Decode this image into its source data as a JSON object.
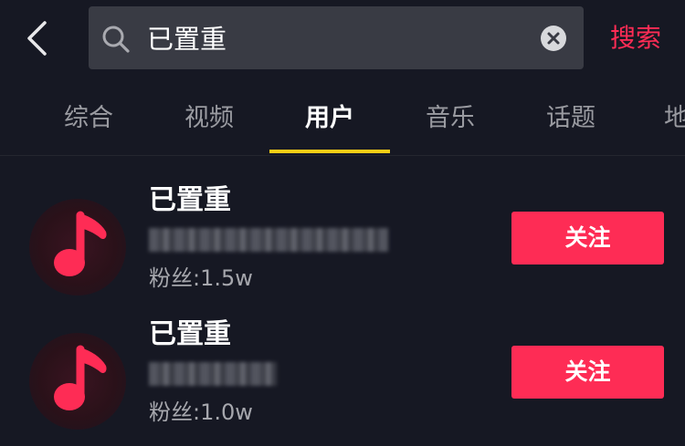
{
  "search": {
    "query": "已置重",
    "submit_label": "搜索"
  },
  "tabs": [
    {
      "label": "综合"
    },
    {
      "label": "视频"
    },
    {
      "label": "用户"
    },
    {
      "label": "音乐"
    },
    {
      "label": "话题"
    },
    {
      "label": "地"
    }
  ],
  "active_tab": "用户",
  "results": [
    {
      "name": "已置重",
      "followers": "粉丝:1.5w",
      "follow_label": "关注"
    },
    {
      "name": "已置重",
      "followers": "粉丝:1.0w",
      "follow_label": "关注"
    }
  ],
  "colors": {
    "background": "#161823",
    "accent": "#fe2c55",
    "tab_indicator": "#face15",
    "search_box": "#393b44"
  }
}
